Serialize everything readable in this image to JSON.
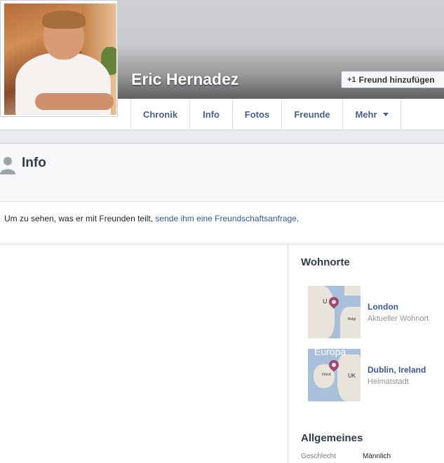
{
  "profile": {
    "name": "Eric Hernadez",
    "add_friend_label": "Freund hinzufügen"
  },
  "tabs": [
    {
      "label": "Chronik"
    },
    {
      "label": "Info"
    },
    {
      "label": "Fotos"
    },
    {
      "label": "Freunde"
    },
    {
      "label": "Mehr"
    }
  ],
  "info": {
    "title": "Info",
    "notice_text": "Um zu sehen, was er mit Freunden teilt, ",
    "notice_link": "sende ihm eine Freundschaftsanfrage",
    "notice_end": "."
  },
  "residences": {
    "title": "Wohnorte",
    "places": [
      {
        "name": "London",
        "type": "Aktueller Wohnort",
        "map_labels": [
          "U",
          "Belgi"
        ]
      },
      {
        "name": "Dublin, Ireland",
        "type": "Heimatstadt",
        "map_labels": [
          "Europa",
          "UK",
          "Irland"
        ]
      }
    ]
  },
  "general": {
    "title": "Allgemeines",
    "rows": [
      {
        "label": "Geschlecht",
        "value": "Männlich"
      }
    ]
  },
  "colors": {
    "link": "#365899",
    "tab_text": "#4b5f8a",
    "place_link": "#3b5998",
    "pin": "#9a4d73"
  }
}
